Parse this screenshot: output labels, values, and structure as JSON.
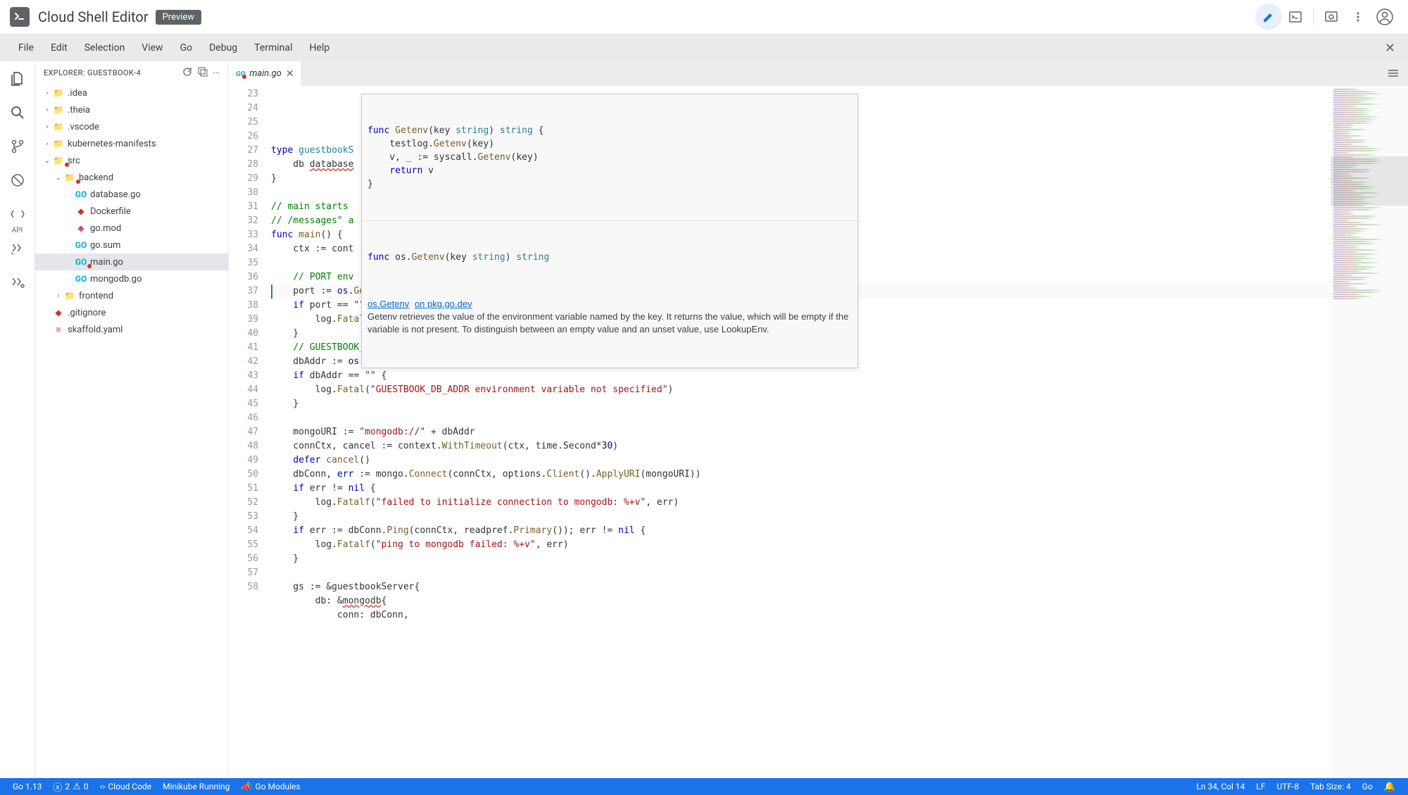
{
  "header": {
    "app_title": "Cloud Shell Editor",
    "badge": "Preview"
  },
  "menubar": {
    "items": [
      "File",
      "Edit",
      "Selection",
      "View",
      "Go",
      "Debug",
      "Terminal",
      "Help"
    ]
  },
  "explorer": {
    "title": "EXPLORER: GUESTBOOK-4",
    "tree": [
      {
        "name": ".idea",
        "type": "folder",
        "depth": 0,
        "chevron": "›"
      },
      {
        "name": ".theia",
        "type": "folder",
        "depth": 0,
        "chevron": "›"
      },
      {
        "name": ".vscode",
        "type": "folder",
        "depth": 0,
        "chevron": "›"
      },
      {
        "name": "kubernetes-manifests",
        "type": "folder",
        "depth": 0,
        "chevron": "›"
      },
      {
        "name": "src",
        "type": "folder-src",
        "depth": 0,
        "chevron": "⌄",
        "error": true
      },
      {
        "name": "backend",
        "type": "folder-src",
        "depth": 1,
        "chevron": "⌄",
        "error": true
      },
      {
        "name": "database.go",
        "type": "go",
        "depth": 2
      },
      {
        "name": "Dockerfile",
        "type": "docker",
        "depth": 2
      },
      {
        "name": "go.mod",
        "type": "mod",
        "depth": 2
      },
      {
        "name": "go.sum",
        "type": "go",
        "depth": 2
      },
      {
        "name": "main.go",
        "type": "go",
        "depth": 2,
        "selected": true,
        "error": true
      },
      {
        "name": "mongodb.go",
        "type": "go",
        "depth": 2
      },
      {
        "name": "frontend",
        "type": "folder",
        "depth": 1,
        "chevron": "›"
      },
      {
        "name": ".gitignore",
        "type": "git",
        "depth": 0
      },
      {
        "name": "skaffold.yaml",
        "type": "yaml",
        "depth": 0
      }
    ]
  },
  "tabs": {
    "active": {
      "label": "main.go",
      "icon": "go"
    }
  },
  "gutter": {
    "start": 23,
    "count": 36
  },
  "code_lines": [
    "",
    "<span class='kw'>type</span> <span class='type'>guestbookS</span>",
    "    db <span class='err-underline'>database</span>",
    "}",
    "",
    "<span class='cm'>// main starts </span>",
    "<span class='cm'>// /messages\" a</span>",
    "<span class='kw'>func</span> <span class='fn'>main</span>() {",
    "    ctx := cont",
    "",
    "    <span class='cm'>// PORT env</span>",
    "    port := <span class='ident'>os</span>.<span class='fn'>Getenv</span>(<span class='str'>\"PORT\"</span>)",
    "    <span class='kw'>if</span> port == <span class='str'>\"\"</span> {",
    "        log.<span class='fn'>Fatal</span>(<span class='str'>\"PORT environment variable not specified\"</span>)",
    "    }",
    "    <span class='cm'>// GUESTBOOK_DB_ADDR environment variable is set in guestbook-backend.deployment.yaml.</span>",
    "    dbAddr := <span class='ident'>os</span>.<span class='fn'>Getenv</span>(<span class='str'>\"GUESTBOOK_DB_ADDR\"</span>)",
    "    <span class='kw'>if</span> dbAddr == <span class='str'>\"\"</span> {",
    "        log.<span class='fn'>Fatal</span>(<span class='str'>\"GUESTBOOK_DB_ADDR environment variable not specified\"</span>)",
    "    }",
    "",
    "    mongoURI := <span class='str'>\"mongodb://\"</span> + dbAddr",
    "    connCtx, cancel := context.<span class='fn'>WithTimeout</span>(ctx, time.Second*<span class='ident'>30</span>)",
    "    <span class='kw'>defer</span> <span class='fn'>cancel</span>()",
    "    dbConn, <span class='ident'>err</span> := mongo.<span class='fn'>Connect</span>(connCtx, options.<span class='fn'>Client</span>().<span class='fn'>ApplyURI</span>(mongoURI))",
    "    <span class='kw'>if</span> err != <span class='kw'>nil</span> {",
    "        log.<span class='fn'>Fatalf</span>(<span class='str'>\"failed to initialize connection to mongodb: %+v\"</span>, err)",
    "    }",
    "    <span class='kw'>if</span> err := dbConn.<span class='fn'>Ping</span>(connCtx, readpref.<span class='fn'>Primary</span>()); err != <span class='kw'>nil</span> {",
    "        log.<span class='fn'>Fatalf</span>(<span class='str'>\"ping to mongodb failed: %+v\"</span>, err)",
    "    }",
    "",
    "    gs := &amp;guestbookServer{",
    "        db: &amp;<span class='err-underline'>mongodb</span>{",
    "            conn: dbConn,",
    ""
  ],
  "hover": {
    "code1": "<span class='kw'>func</span> <span class='fn'>Getenv</span>(key <span class='type'>string</span>) <span class='type'>string</span> {\n    testlog.<span class='fn'>Getenv</span>(key)\n    v, _ := syscall.<span class='fn'>Getenv</span>(key)\n    <span class='kw'>return</span> v\n}",
    "code2": "<span class='kw'>func</span> os.<span class='fn'>Getenv</span>(key <span class='type'>string</span>) <span class='type'>string</span>",
    "link_text": "os.Getenv",
    "link_suffix": "on pkg.go.dev",
    "doc": "Getenv retrieves the value of the environment variable named by the key. It returns the value, which will be empty if the variable is not present. To distinguish between an empty value and an unset value, use LookupEnv."
  },
  "statusbar": {
    "go_version": "Go 1.13",
    "errors": "2",
    "warnings": "0",
    "cloud_code": "Cloud Code",
    "minikube": "Minikube Running",
    "go_modules": "Go Modules",
    "cursor": "Ln 34, Col 14",
    "eol": "LF",
    "encoding": "UTF-8",
    "tabsize": "Tab Size: 4",
    "lang": "Go"
  }
}
